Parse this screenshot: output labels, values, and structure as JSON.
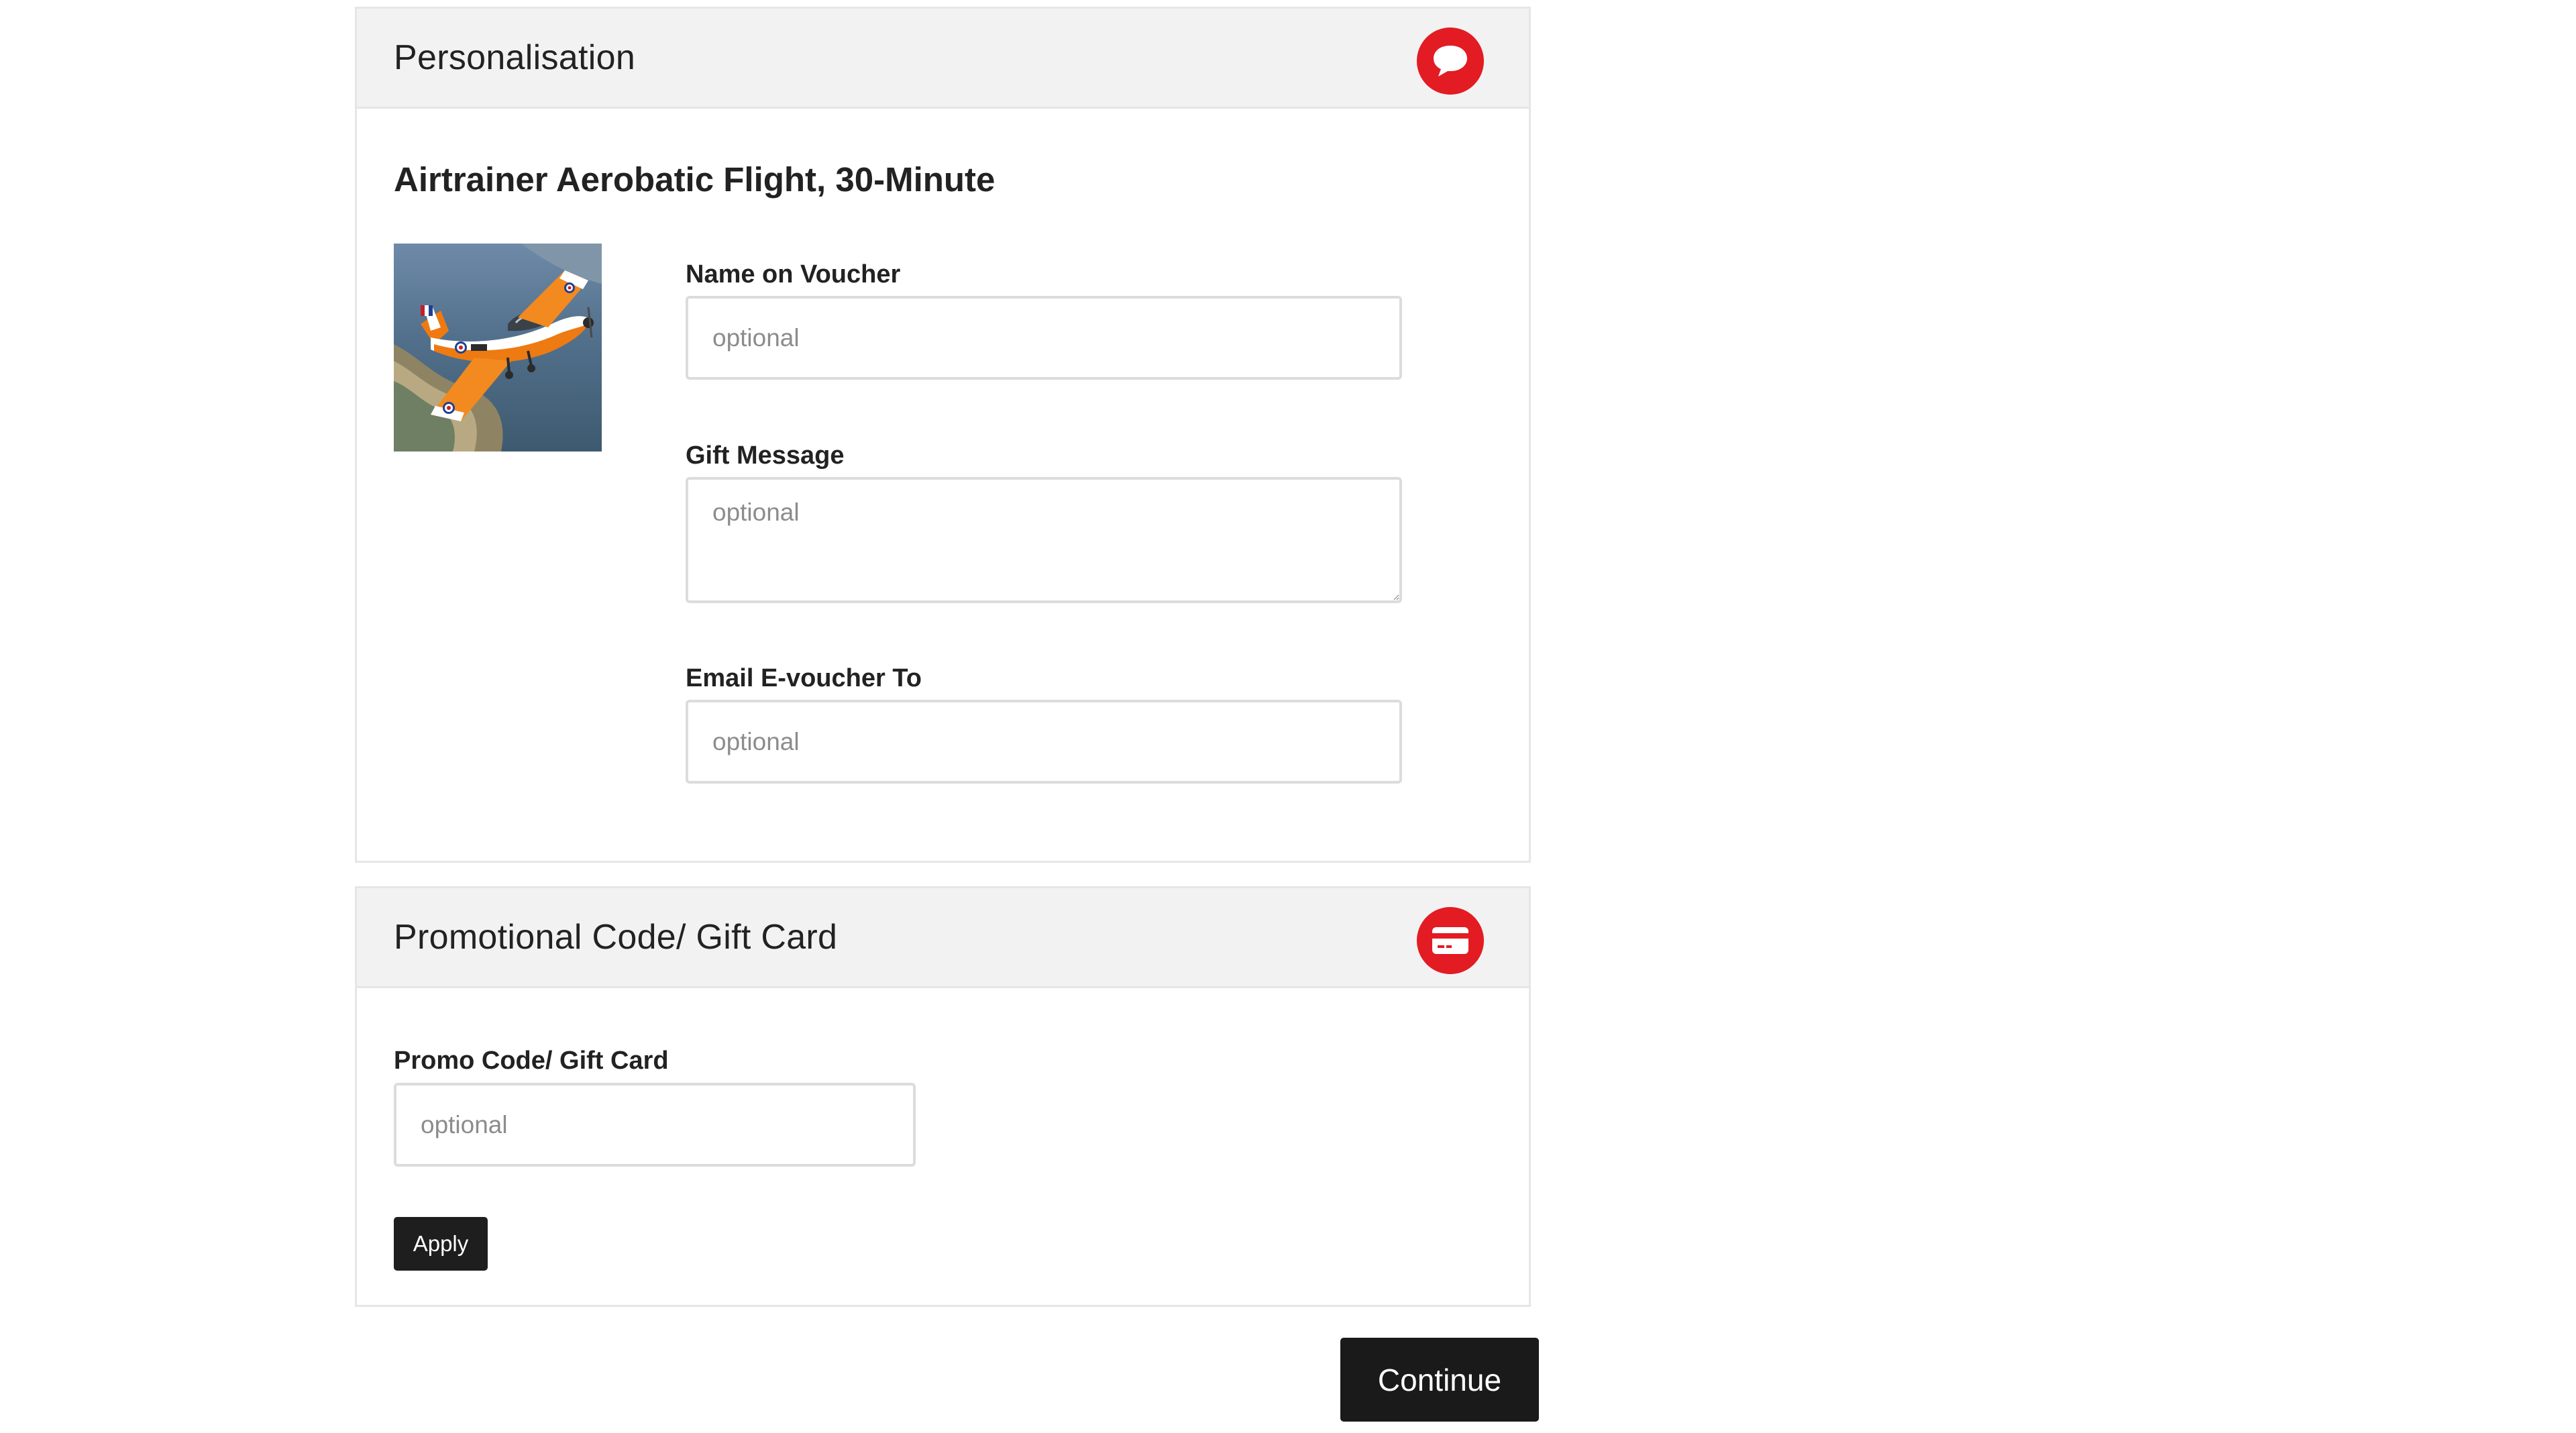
{
  "personalisation": {
    "title": "Personalisation",
    "header_icon": "chat-bubble-icon",
    "product_title": "Airtrainer Aerobatic Flight, 30-Minute",
    "product_image": "orange-white-aircraft-in-flight-over-coast",
    "fields": {
      "name_on_voucher": {
        "label": "Name on Voucher",
        "placeholder": "optional",
        "value": ""
      },
      "gift_message": {
        "label": "Gift Message",
        "placeholder": "optional",
        "value": ""
      },
      "email_evoucher_to": {
        "label": "Email E-voucher To",
        "placeholder": "optional",
        "value": ""
      }
    }
  },
  "promo": {
    "title": "Promotional Code/ Gift Card",
    "header_icon": "credit-card-icon",
    "field": {
      "label": "Promo Code/ Gift Card",
      "placeholder": "optional",
      "value": ""
    },
    "apply_label": "Apply"
  },
  "continue_label": "Continue",
  "colors": {
    "accent_red": "#e31b23",
    "button_dark": "#1e1e1e",
    "header_bg": "#f2f2f2",
    "border": "#e6e6e6"
  }
}
